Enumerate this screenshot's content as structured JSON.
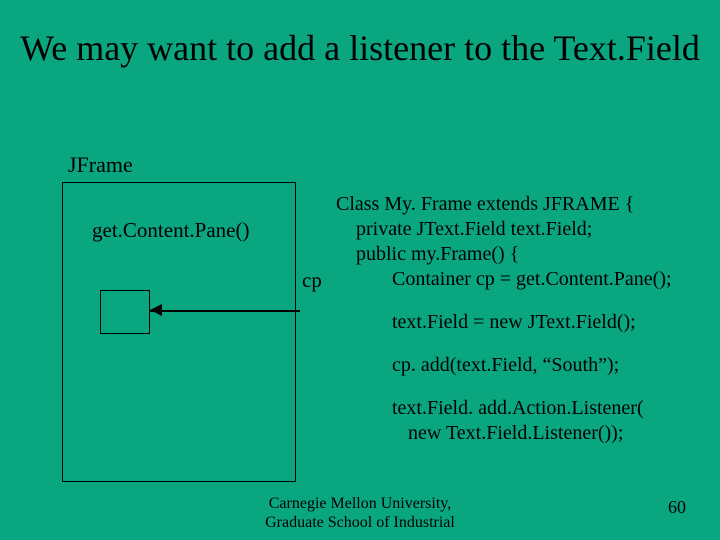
{
  "title": "We may want to add a listener to the Text.Field",
  "labels": {
    "jframe": "JFrame",
    "gcp": "get.Content.Pane()",
    "cp": "cp"
  },
  "code": {
    "l1": "Class My. Frame extends JFRAME {",
    "l2": "private JText.Field text.Field;",
    "l3": "public my.Frame() {",
    "l4": "Container cp = get.Content.Pane();",
    "l5": "text.Field = new JText.Field();",
    "l6": "cp. add(text.Field, “South”);",
    "l7": "text.Field. add.Action.Listener(",
    "l8": "new Text.Field.Listener());"
  },
  "footer": {
    "l1": "Carnegie Mellon University,",
    "l2": "Graduate School of Industrial"
  },
  "page": "60"
}
